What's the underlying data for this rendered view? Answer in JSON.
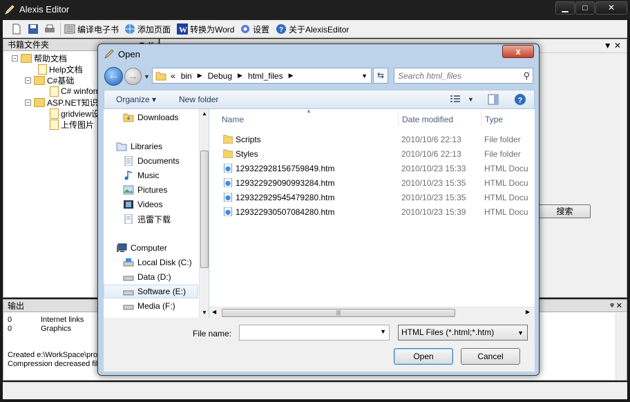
{
  "app": {
    "title": "Alexis Editor",
    "controls": {
      "minimize": "▁",
      "maximize": "□",
      "close": "✕"
    }
  },
  "toolbar": {
    "compile_ebook": "编译电子书",
    "add_page": "添加页面",
    "convert_word": "转换为Word",
    "settings": "设置",
    "about": "关于AlexisEditor"
  },
  "left_panel": {
    "title": "书籍文件夹",
    "pin": "▼ ✕",
    "tree": [
      {
        "label": "帮助文档",
        "box": "−"
      },
      {
        "label": "Help文档"
      },
      {
        "label": "C#基础",
        "box": "−"
      },
      {
        "label": "C# winform"
      },
      {
        "label": "ASP.NET知识",
        "box": "−"
      },
      {
        "label": "gridview设"
      },
      {
        "label": "上传图片"
      }
    ]
  },
  "right_area": {
    "tab_close": "▼ ✕",
    "search_button": "搜索"
  },
  "output": {
    "title": "输出",
    "pin": "ᵠ ✕",
    "lines": [
      {
        "num": "0",
        "text": "Internet links"
      },
      {
        "num": "0",
        "text": "Graphics"
      }
    ],
    "log": [
      "Created e:\\WorkSpace\\pro",
      "Compression decreased file"
    ]
  },
  "dialog": {
    "title": "Open",
    "close": "x",
    "address": {
      "overflow": "«",
      "crumbs": [
        "bin",
        "Debug",
        "html_files"
      ]
    },
    "search_placeholder": "Search html_files",
    "commands": {
      "organize": "Organize ▾",
      "new_folder": "New folder"
    },
    "nav": [
      {
        "label": "Downloads",
        "icon": "downloads-icon"
      },
      {
        "label": "Libraries",
        "icon": "libraries-icon"
      },
      {
        "label": "Documents",
        "icon": "documents-icon"
      },
      {
        "label": "Music",
        "icon": "music-icon"
      },
      {
        "label": "Pictures",
        "icon": "pictures-icon"
      },
      {
        "label": "Videos",
        "icon": "videos-icon"
      },
      {
        "label": "迅雷下载",
        "icon": "folder-icon"
      },
      {
        "label": "Computer",
        "icon": "computer-icon"
      },
      {
        "label": "Local Disk (C:)",
        "icon": "drive-icon"
      },
      {
        "label": "Data (D:)",
        "icon": "drive-icon"
      },
      {
        "label": "Software (E:)",
        "icon": "drive-icon",
        "selected": true
      },
      {
        "label": "Media (F:)",
        "icon": "drive-icon"
      }
    ],
    "columns": {
      "name": "Name",
      "date": "Date modified",
      "type": "Type"
    },
    "files": [
      {
        "name": "Scripts",
        "date": "2010/10/6 22:13",
        "type": "File folder",
        "kind": "folder"
      },
      {
        "name": "Styles",
        "date": "2010/10/6 22:13",
        "type": "File folder",
        "kind": "folder"
      },
      {
        "name": "129322928156759849.htm",
        "date": "2010/10/23 15:33",
        "type": "HTML Docu",
        "kind": "html"
      },
      {
        "name": "129322929090993284.htm",
        "date": "2010/10/23 15:35",
        "type": "HTML Docu",
        "kind": "html"
      },
      {
        "name": "129322929545479280.htm",
        "date": "2010/10/23 15:35",
        "type": "HTML Docu",
        "kind": "html"
      },
      {
        "name": "129322930507084280.htm",
        "date": "2010/10/23 15:39",
        "type": "HTML Docu",
        "kind": "html"
      }
    ],
    "file_name_label": "File name:",
    "file_name_value": "",
    "filter": "HTML Files (*.html;*.htm)",
    "open_button": "Open",
    "cancel_button": "Cancel"
  }
}
